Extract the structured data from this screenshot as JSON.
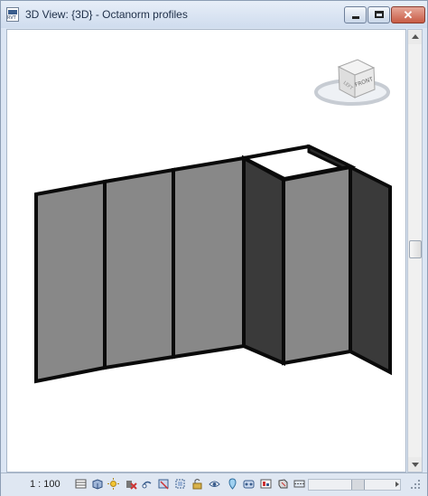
{
  "window": {
    "title": "3D View: {3D} - Octanorm profiles",
    "close_glyph": "✕"
  },
  "viewcube": {
    "face_label": "FRONT",
    "side_label": "LEFT"
  },
  "statusbar": {
    "scale": "1 : 100",
    "tools": [
      "detail-level-icon",
      "visual-style-icon",
      "sun-path-icon",
      "shadows-icon",
      "render-dialog-icon",
      "crop-view-icon",
      "crop-region-icon",
      "unlock-view-icon",
      "temporary-hide-icon",
      "reveal-hidden-icon",
      "workset-icon",
      "analysis-display-icon",
      "highlight-displacement-icon"
    ]
  },
  "colors": {
    "panel_light": "#8a8a8a",
    "panel_dark": "#3a3a3a",
    "frame": "#0a0a0a",
    "titlebar": "#dce6f4"
  }
}
